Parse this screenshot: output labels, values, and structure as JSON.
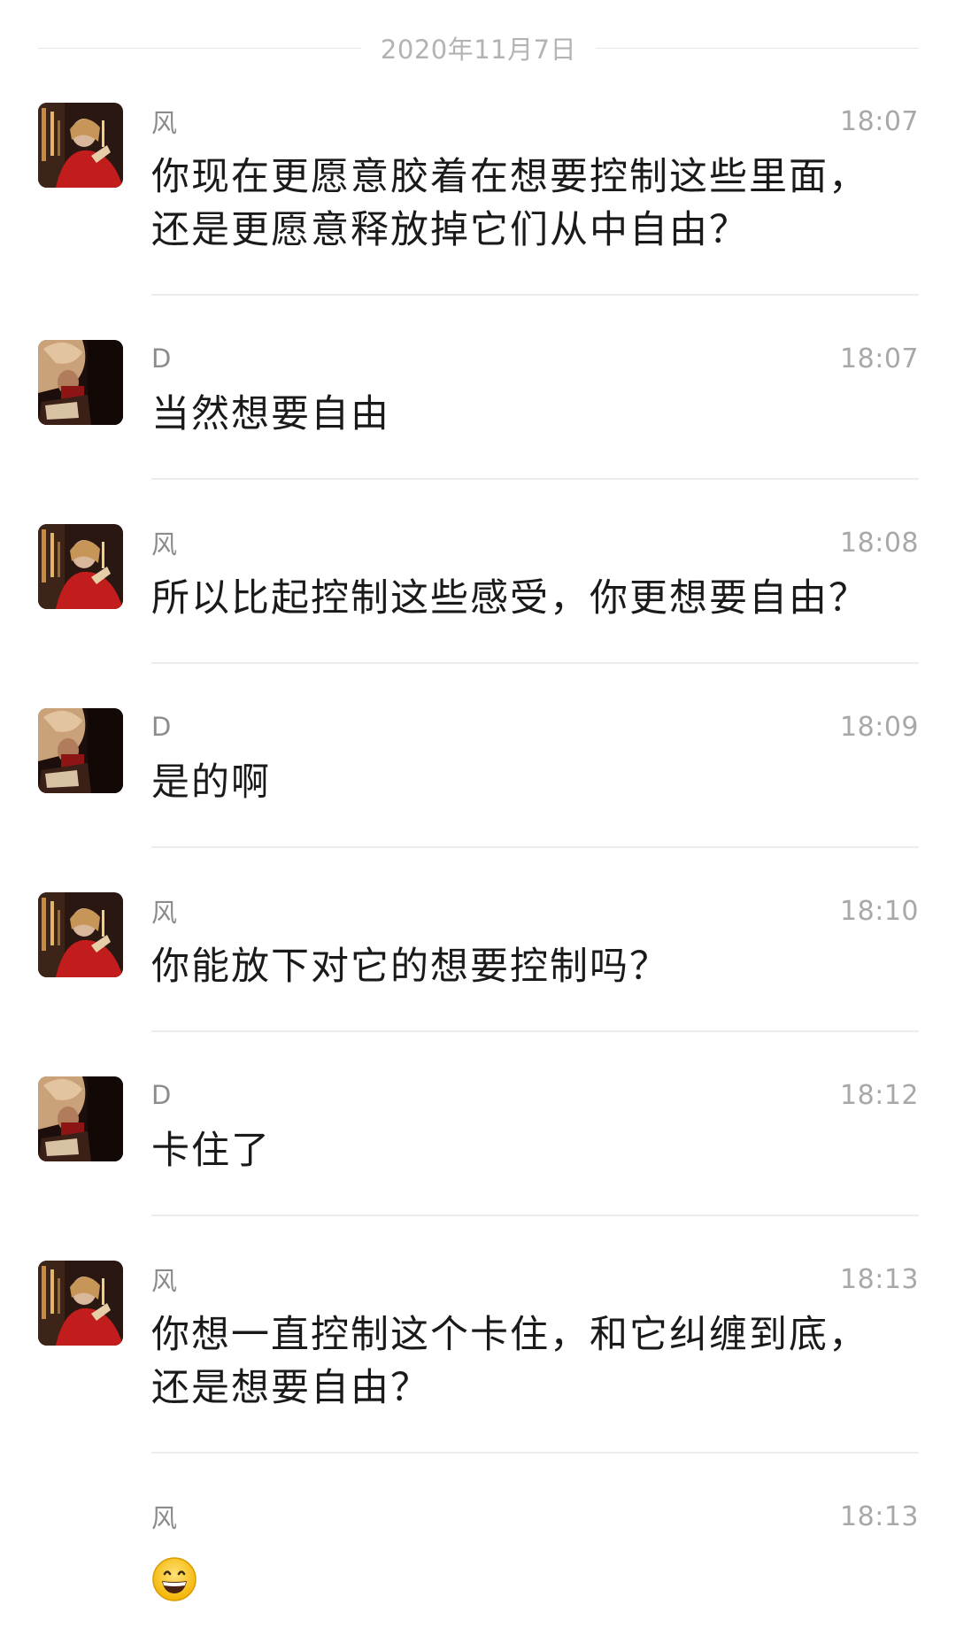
{
  "date_divider": "2020年11月7日",
  "messages": [
    {
      "sender": "风",
      "time": "18:07",
      "text": "你现在更愿意胶着在想要控制这些里面，\n还是更愿意释放掉它们从中自由？",
      "avatar": "avatar-feng"
    },
    {
      "sender": "D",
      "time": "18:07",
      "text": "当然想要自由",
      "avatar": "avatar-d"
    },
    {
      "sender": "风",
      "time": "18:08",
      "text": "所以比起控制这些感受，你更想要自由？",
      "avatar": "avatar-feng"
    },
    {
      "sender": "D",
      "time": "18:09",
      "text": "是的啊",
      "avatar": "avatar-d"
    },
    {
      "sender": "风",
      "time": "18:10",
      "text": "你能放下对它的想要控制吗？",
      "avatar": "avatar-feng"
    },
    {
      "sender": "D",
      "time": "18:12",
      "text": "卡住了",
      "avatar": "avatar-d"
    },
    {
      "sender": "风",
      "time": "18:13",
      "text": "你想一直控制这个卡住，和它纠缠到底，\n还是想要自由？",
      "avatar": "avatar-feng"
    },
    {
      "sender": "风",
      "time": "18:13",
      "text": "",
      "emoji": "grinning-face-icon",
      "avatar": "none"
    }
  ]
}
